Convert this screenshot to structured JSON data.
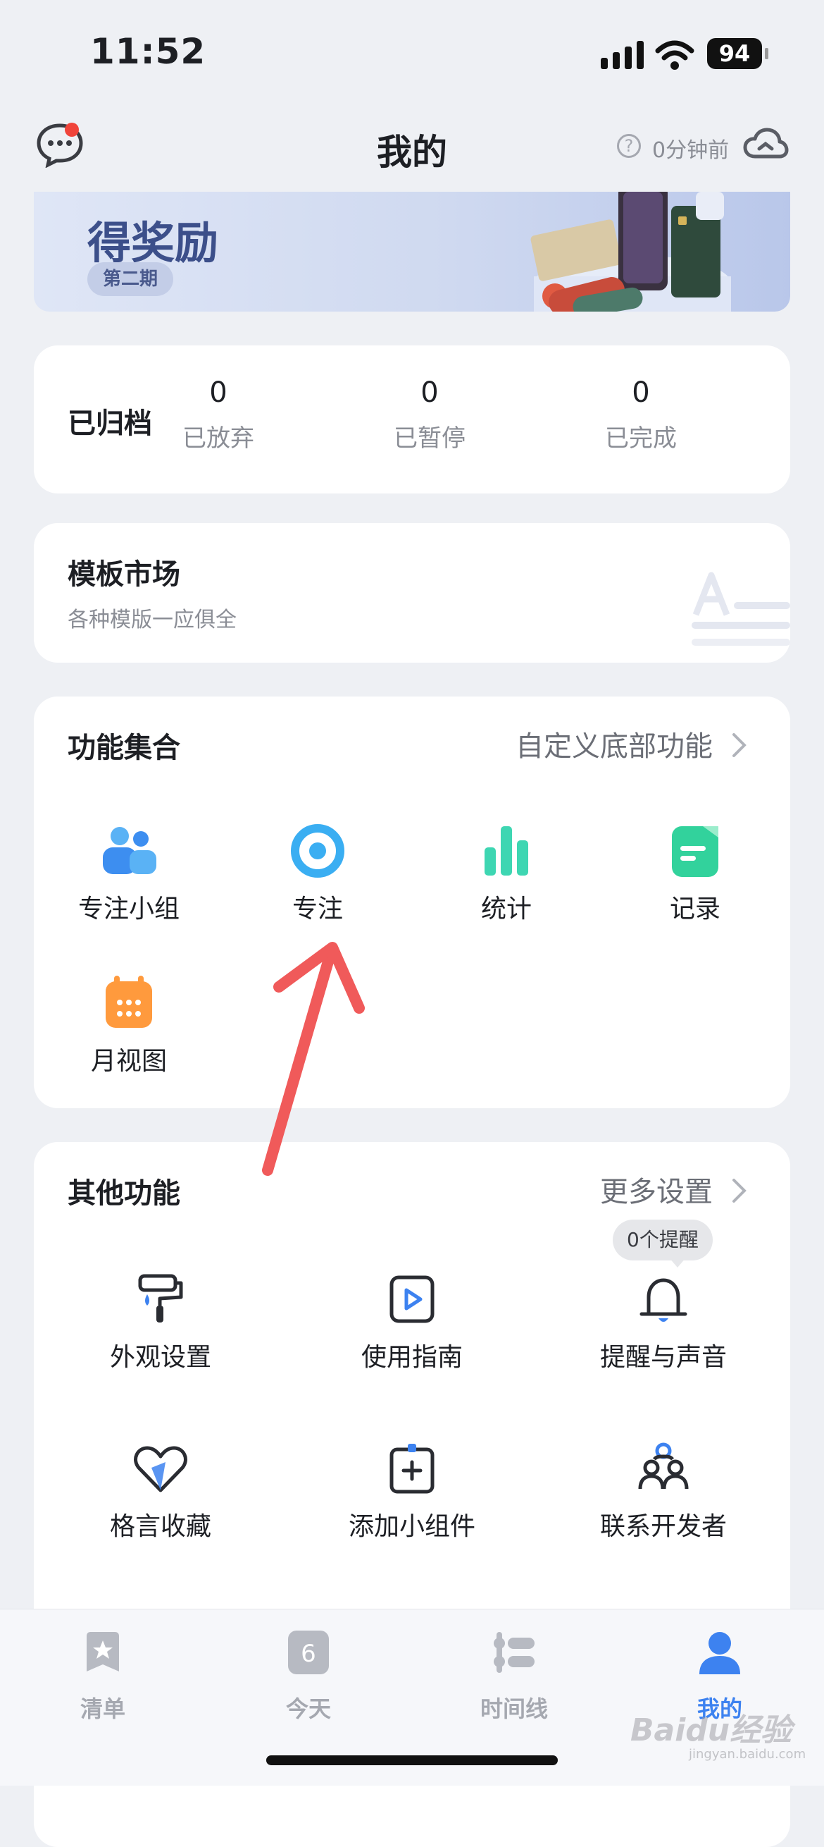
{
  "status_bar": {
    "time": "11:52",
    "battery": "94"
  },
  "header": {
    "title": "我的",
    "sync_time": "0分钟前"
  },
  "banner": {
    "title": "得奖励",
    "badge": "第二期"
  },
  "archive": {
    "label": "已归档",
    "stats": [
      {
        "value": "0",
        "label": "已放弃"
      },
      {
        "value": "0",
        "label": "已暂停"
      },
      {
        "value": "0",
        "label": "已完成"
      }
    ]
  },
  "template_market": {
    "title": "模板市场",
    "subtitle": "各种模版一应俱全"
  },
  "features": {
    "title": "功能集合",
    "link": "自定义底部功能",
    "items": [
      {
        "label": "专注小组",
        "icon": "group-icon"
      },
      {
        "label": "专注",
        "icon": "focus-icon"
      },
      {
        "label": "统计",
        "icon": "stats-icon"
      },
      {
        "label": "记录",
        "icon": "record-icon"
      },
      {
        "label": "月视图",
        "icon": "calendar-icon"
      }
    ]
  },
  "other": {
    "title": "其他功能",
    "link": "更多设置",
    "reminder_badge": "0个提醒",
    "items": [
      {
        "label": "外观设置",
        "icon": "paint-roller-icon"
      },
      {
        "label": "使用指南",
        "icon": "play-guide-icon"
      },
      {
        "label": "提醒与声音",
        "icon": "bell-icon"
      },
      {
        "label": "格言收藏",
        "icon": "heart-icon"
      },
      {
        "label": "添加小组件",
        "icon": "add-widget-icon"
      },
      {
        "label": "联系开发者",
        "icon": "contact-developer-icon"
      }
    ]
  },
  "tabbar": {
    "items": [
      {
        "label": "清单",
        "icon": "list-star-icon"
      },
      {
        "label": "今天",
        "icon": "today-icon",
        "number": "6"
      },
      {
        "label": "时间线",
        "icon": "timeline-icon"
      },
      {
        "label": "我的",
        "icon": "profile-icon"
      }
    ],
    "active": "我的"
  },
  "watermark": {
    "text": "Baidu经验",
    "sub": "jingyan.baidu.com"
  },
  "colors": {
    "accent": "#3d82f0",
    "background": "#eef0f4",
    "arrow": "#f05a5a"
  }
}
